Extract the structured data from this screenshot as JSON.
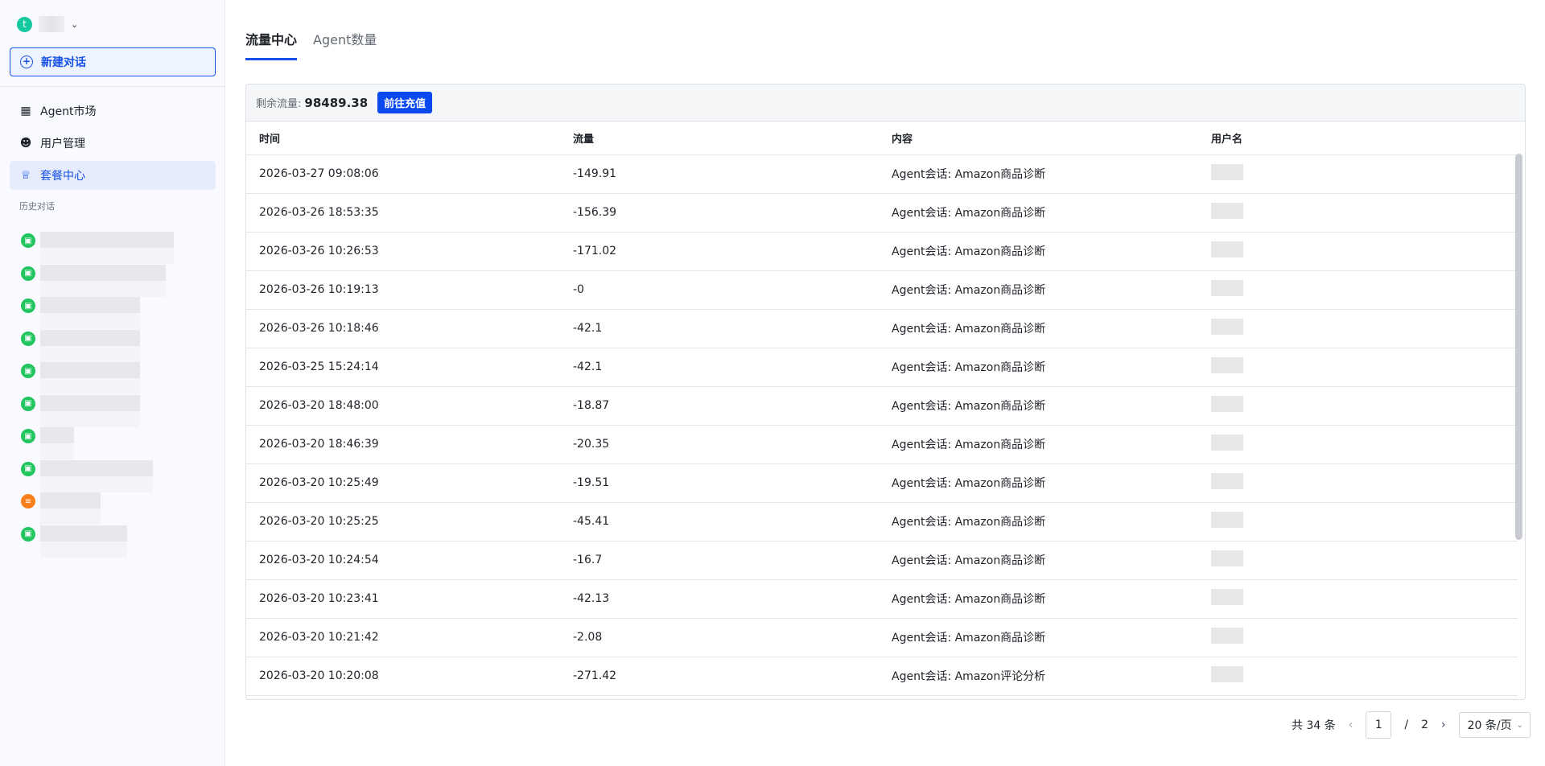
{
  "user": {
    "initial": "t"
  },
  "sidebar": {
    "new_chat": "新建对话",
    "items": [
      {
        "label": "Agent市场",
        "icon": "apps-icon"
      },
      {
        "label": "用户管理",
        "icon": "users-icon"
      },
      {
        "label": "套餐中心",
        "icon": "crown-icon"
      }
    ],
    "history_label": "历史对话",
    "history": [
      {
        "type": "agent"
      },
      {
        "type": "agent"
      },
      {
        "type": "agent"
      },
      {
        "type": "agent"
      },
      {
        "type": "agent"
      },
      {
        "type": "agent"
      },
      {
        "type": "agent"
      },
      {
        "type": "agent"
      },
      {
        "type": "chat"
      },
      {
        "type": "agent"
      }
    ]
  },
  "tabs": [
    "流量中心",
    "Agent数量"
  ],
  "panel": {
    "balance_label": "剩余流量:",
    "balance": "98489.38",
    "recharge": "前往充值"
  },
  "table": {
    "headers": [
      "时间",
      "流量",
      "内容",
      "用户名"
    ],
    "rows": [
      [
        "2026-03-27 09:08:06",
        "-149.91",
        "Agent会话: Amazon商品诊断"
      ],
      [
        "2026-03-26 18:53:35",
        "-156.39",
        "Agent会话: Amazon商品诊断"
      ],
      [
        "2026-03-26 10:26:53",
        "-171.02",
        "Agent会话: Amazon商品诊断"
      ],
      [
        "2026-03-26 10:19:13",
        "-0",
        "Agent会话: Amazon商品诊断"
      ],
      [
        "2026-03-26 10:18:46",
        "-42.1",
        "Agent会话: Amazon商品诊断"
      ],
      [
        "2026-03-25 15:24:14",
        "-42.1",
        "Agent会话: Amazon商品诊断"
      ],
      [
        "2026-03-20 18:48:00",
        "-18.87",
        "Agent会话: Amazon商品诊断"
      ],
      [
        "2026-03-20 18:46:39",
        "-20.35",
        "Agent会话: Amazon商品诊断"
      ],
      [
        "2026-03-20 10:25:49",
        "-19.51",
        "Agent会话: Amazon商品诊断"
      ],
      [
        "2026-03-20 10:25:25",
        "-45.41",
        "Agent会话: Amazon商品诊断"
      ],
      [
        "2026-03-20 10:24:54",
        "-16.7",
        "Agent会话: Amazon商品诊断"
      ],
      [
        "2026-03-20 10:23:41",
        "-42.13",
        "Agent会话: Amazon商品诊断"
      ],
      [
        "2026-03-20 10:21:42",
        "-2.08",
        "Agent会话: Amazon商品诊断"
      ],
      [
        "2026-03-20 10:20:08",
        "-271.42",
        "Agent会话: Amazon评论分析"
      ]
    ]
  },
  "pagination": {
    "total": "共 34 条",
    "current": "1",
    "separator": "/",
    "pages": "2",
    "page_size": "20 条/页"
  }
}
